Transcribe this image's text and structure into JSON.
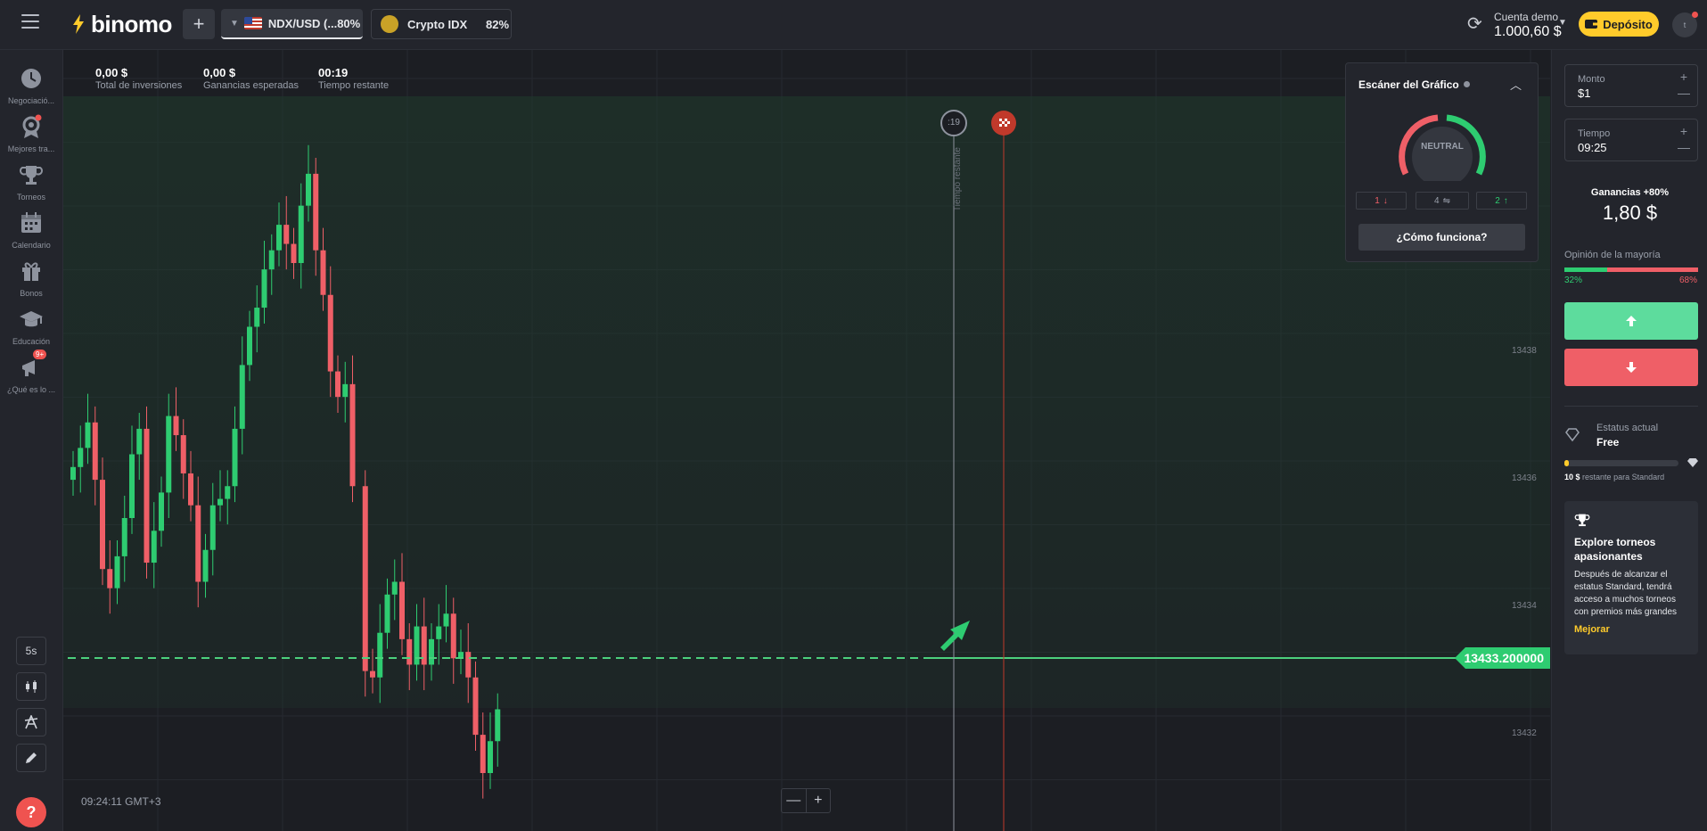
{
  "header": {
    "logo_text": "binomo",
    "add_label": "+",
    "tabs": [
      {
        "name": "NDX/USD (...80%",
        "active": true
      },
      {
        "name": "Crypto IDX",
        "payout": "82%",
        "active": false
      }
    ],
    "account": {
      "label": "Cuenta demo",
      "balance": "1.000,60 $"
    },
    "deposit_label": "Depósito",
    "avatar_initial": "t"
  },
  "sidebar": {
    "items": [
      {
        "label": "Negociació...",
        "icon": "history-icon"
      },
      {
        "label": "Mejores tra...",
        "icon": "top-traders-icon"
      },
      {
        "label": "Torneos",
        "icon": "trophy-icon"
      },
      {
        "label": "Calendario",
        "icon": "calendar-icon"
      },
      {
        "label": "Bonos",
        "icon": "gift-icon"
      },
      {
        "label": "Educación",
        "icon": "graduation-cap-icon"
      },
      {
        "label": "¿Qué es lo ...",
        "icon": "whats-new-icon",
        "badge": "9+"
      }
    ],
    "tools": {
      "timeframe": "5s"
    },
    "help_label": "?"
  },
  "chart": {
    "stats": [
      {
        "value": "0,00 $",
        "label": "Total de inversiones"
      },
      {
        "value": "0,00 $",
        "label": "Ganancias esperadas"
      },
      {
        "value": "00:19",
        "label": "Tiempo restante"
      }
    ],
    "timer_badge": ":19",
    "vertical_label": "Tiempo restante",
    "timestamp": "09:24:11 GMT+3",
    "current_price": "13433.200000",
    "y_ticks": [
      "13438",
      "13436",
      "13434",
      "13432"
    ],
    "zoom": {
      "minus": "—",
      "plus": "+"
    },
    "colors": {
      "up": "#2ecc71",
      "down": "#ef5f67",
      "line": "#4cd07d"
    }
  },
  "scanner": {
    "title": "Escáner del Gráfico",
    "state": "NEUTRAL",
    "sell_count": "1",
    "neutral_count": "4",
    "buy_count": "2",
    "button": "¿Cómo funciona?"
  },
  "trade": {
    "amount_label": "Monto",
    "amount_value": "$1",
    "time_label": "Tiempo",
    "time_value": "09:25",
    "payout_label": "Ganancias +80%",
    "payout_value": "1,80 $",
    "majority_label": "Opinión de la mayoría",
    "majority_up": "32%",
    "majority_down": "68%",
    "majority_up_frac": 0.32,
    "status_label": "Estatus actual",
    "status_value": "Free",
    "progress_amount": "10 $",
    "progress_text": "restante para Standard",
    "progress_frac": 0.04
  },
  "promo": {
    "title": "Explore torneos apasionantes",
    "text": "Después de alcanzar el estatus Standard, tendrá acceso a muchos torneos con premios más grandes",
    "link": "Mejorar"
  }
}
